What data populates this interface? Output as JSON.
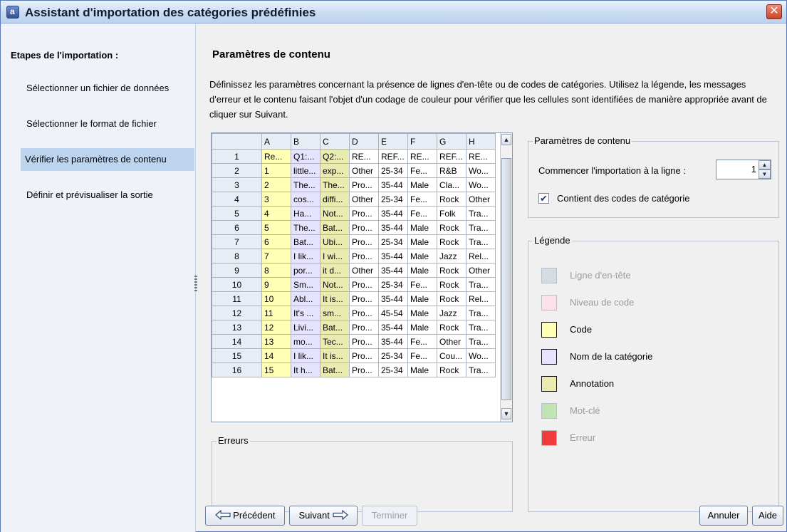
{
  "window": {
    "title": "Assistant d'importation des catégories prédéfinies",
    "close_glyph": "✕"
  },
  "sidebar": {
    "title": "Etapes de l'importation :",
    "steps": [
      {
        "label": "Sélectionner un fichier de données"
      },
      {
        "label": "Sélectionner le format de fichier"
      },
      {
        "label": "Vérifier les paramètres de contenu"
      },
      {
        "label": "Définir et prévisualiser la sortie"
      }
    ]
  },
  "main": {
    "title": "Paramètres de contenu",
    "description": "Définissez les paramètres concernant la présence de lignes d'en-tête ou de codes de catégories. Utilisez la légende, les messages d'erreur et le contenu faisant l'objet d'un codage de couleur pour vérifier que les cellules sont identifiées de manière appropriée avant de cliquer sur Suivant."
  },
  "grid": {
    "columns": [
      "",
      "A",
      "B",
      "C",
      "D",
      "E",
      "F",
      "G",
      "H"
    ],
    "rows": [
      [
        "1",
        "Re...",
        "Q1:...",
        "Q2:...",
        "RE...",
        "REF...",
        "RE...",
        "REF...",
        "RE..."
      ],
      [
        "2",
        "1",
        "little...",
        "exp...",
        "Other",
        "25-34",
        "Fe...",
        "R&B",
        "Wo..."
      ],
      [
        "3",
        "2",
        "The...",
        "The...",
        "Pro...",
        "35-44",
        "Male",
        "Cla...",
        "Wo..."
      ],
      [
        "4",
        "3",
        "cos...",
        "diffi...",
        "Other",
        "25-34",
        "Fe...",
        "Rock",
        "Other"
      ],
      [
        "5",
        "4",
        "Ha...",
        "Not...",
        "Pro...",
        "35-44",
        "Fe...",
        "Folk",
        "Tra..."
      ],
      [
        "6",
        "5",
        "The...",
        "Bat...",
        "Pro...",
        "35-44",
        "Male",
        "Rock",
        "Tra..."
      ],
      [
        "7",
        "6",
        "Bat...",
        "Ubi...",
        "Pro...",
        "25-34",
        "Male",
        "Rock",
        "Tra..."
      ],
      [
        "8",
        "7",
        "I lik...",
        "I wi...",
        "Pro...",
        "35-44",
        "Male",
        "Jazz",
        "Rel..."
      ],
      [
        "9",
        "8",
        "por...",
        "it d...",
        "Other",
        "35-44",
        "Male",
        "Rock",
        "Other"
      ],
      [
        "10",
        "9",
        "Sm...",
        "Not...",
        "Pro...",
        "25-34",
        "Fe...",
        "Rock",
        "Tra..."
      ],
      [
        "11",
        "10",
        "Abl...",
        "It is...",
        "Pro...",
        "35-44",
        "Male",
        "Rock",
        "Rel..."
      ],
      [
        "12",
        "11",
        "It's ...",
        "sm...",
        "Pro...",
        "45-54",
        "Male",
        "Jazz",
        "Tra..."
      ],
      [
        "13",
        "12",
        "Livi...",
        "Bat...",
        "Pro...",
        "35-44",
        "Male",
        "Rock",
        "Tra..."
      ],
      [
        "14",
        "13",
        "mo...",
        "Tec...",
        "Pro...",
        "35-44",
        "Fe...",
        "Other",
        "Tra..."
      ],
      [
        "15",
        "14",
        "I lik...",
        "It is...",
        "Pro...",
        "25-34",
        "Fe...",
        "Cou...",
        "Wo..."
      ],
      [
        "16",
        "15",
        "It h...",
        "Bat...",
        "Pro...",
        "25-34",
        "Male",
        "Rock",
        "Tra..."
      ]
    ]
  },
  "content_settings": {
    "group_label": "Paramètres de contenu",
    "start_row_label": "Commencer l'importation à la ligne :",
    "start_row_value": "1",
    "contains_codes_label": "Contient des codes de catégorie",
    "contains_codes_checked": true,
    "check_glyph": "✔"
  },
  "legend": {
    "group_label": "Légende",
    "items": [
      {
        "label": "Ligne d'en-tête",
        "color": "#d3dbe3",
        "enabled": false
      },
      {
        "label": "Niveau de code",
        "color": "#fde1e8",
        "enabled": false
      },
      {
        "label": "Code",
        "color": "#ffffb6",
        "enabled": true
      },
      {
        "label": "Nom de la catégorie",
        "color": "#e6e3ff",
        "enabled": true
      },
      {
        "label": "Annotation",
        "color": "#e9ebb1",
        "enabled": true
      },
      {
        "label": "Mot-clé",
        "color": "#c1e4b4",
        "enabled": false
      },
      {
        "label": "Erreur",
        "color": "#f23c3c",
        "enabled": false
      }
    ]
  },
  "errors": {
    "group_label": "Erreurs"
  },
  "buttons": {
    "previous": "Précédent",
    "next": "Suivant",
    "finish": "Terminer",
    "cancel": "Annuler",
    "help": "Aide"
  },
  "colors": {
    "accent": "#bcd4ee",
    "row_header": "#e7edf5",
    "title_bar": "#c9dcf3"
  }
}
